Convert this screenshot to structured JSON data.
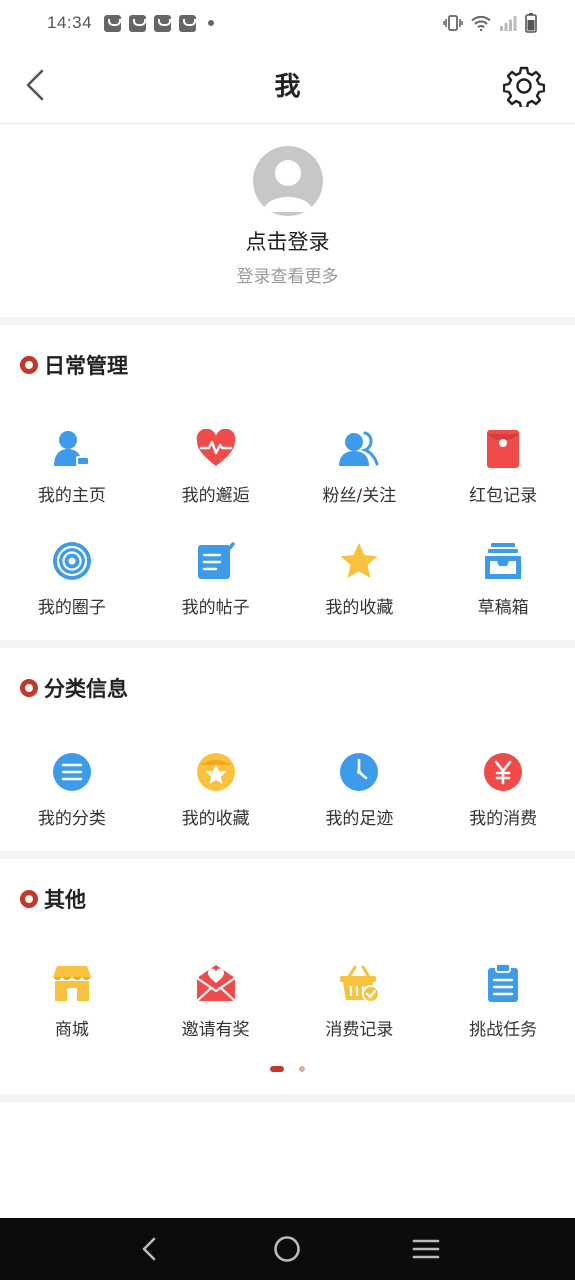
{
  "status": {
    "time": "14:34"
  },
  "header": {
    "title": "我"
  },
  "profile": {
    "login_title": "点击登录",
    "login_subtitle": "登录查看更多"
  },
  "sections": [
    {
      "title": "日常管理",
      "items": [
        {
          "label": "我的主页",
          "icon": "user-home-icon"
        },
        {
          "label": "我的邂逅",
          "icon": "heart-pulse-icon"
        },
        {
          "label": "粉丝/关注",
          "icon": "users-icon"
        },
        {
          "label": "红包记录",
          "icon": "red-envelope-icon"
        },
        {
          "label": "我的圈子",
          "icon": "target-circle-icon"
        },
        {
          "label": "我的帖子",
          "icon": "note-edit-icon"
        },
        {
          "label": "我的收藏",
          "icon": "star-icon"
        },
        {
          "label": "草稿箱",
          "icon": "inbox-tray-icon"
        }
      ]
    },
    {
      "title": "分类信息",
      "items": [
        {
          "label": "我的分类",
          "icon": "list-icon"
        },
        {
          "label": "我的收藏",
          "icon": "star-badge-icon"
        },
        {
          "label": "我的足迹",
          "icon": "clock-icon"
        },
        {
          "label": "我的消费",
          "icon": "yuan-icon"
        }
      ]
    },
    {
      "title": "其他",
      "items": [
        {
          "label": "商城",
          "icon": "shop-icon"
        },
        {
          "label": "邀请有奖",
          "icon": "envelope-heart-icon"
        },
        {
          "label": "消费记录",
          "icon": "basket-check-icon"
        },
        {
          "label": "挑战任务",
          "icon": "clipboard-icon"
        }
      ]
    }
  ],
  "colors": {
    "accent": "#c0392b",
    "blue": "#3d9be9",
    "red": "#ef4b4b",
    "yellow": "#f9c23c"
  }
}
